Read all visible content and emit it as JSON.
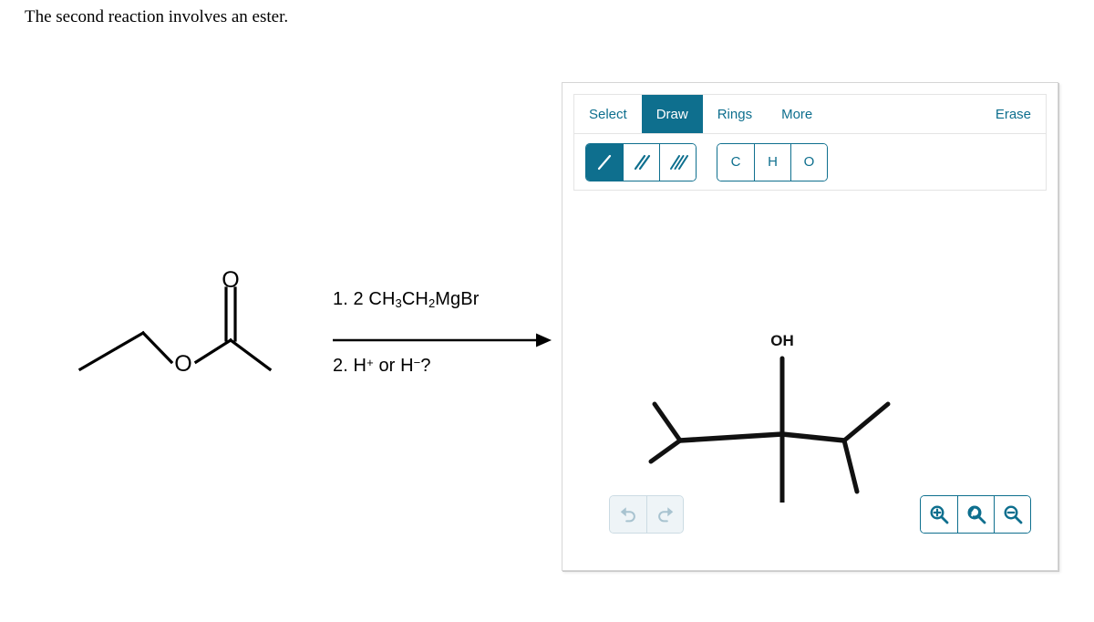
{
  "prompt": "The second reaction involves an ester.",
  "reaction": {
    "reagent_line_1_prefix": "1. 2 CH",
    "reagent_line_1": "1. 2 CH3CH2MgBr",
    "reagent_line_2": "2. H+ or H-?",
    "parts_line_1": {
      "num": "1. 2 CH",
      "sub1": "3",
      "mid": "CH",
      "sub2": "2",
      "tail": "MgBr"
    },
    "parts_line_2": {
      "num": "2. H",
      "sup1": "+",
      "mid": " or H",
      "sup2": "−",
      "tail": "?"
    },
    "reactant_name": "ethyl-acetate-structure",
    "reactant_atom_label": "O",
    "reactant_carbonyl_label": "O",
    "arrow": "reaction-arrow"
  },
  "editor": {
    "tabs": [
      {
        "label": "Select",
        "name": "tab-select",
        "active": false
      },
      {
        "label": "Draw",
        "name": "tab-draw",
        "active": true
      },
      {
        "label": "Rings",
        "name": "tab-rings",
        "active": false
      },
      {
        "label": "More",
        "name": "tab-more",
        "active": false
      }
    ],
    "erase_label": "Erase",
    "bond_buttons": [
      {
        "icon": "single-bond-icon",
        "active": true
      },
      {
        "icon": "double-bond-icon",
        "active": false
      },
      {
        "icon": "triple-bond-icon",
        "active": false
      }
    ],
    "atom_buttons": [
      {
        "label": "C",
        "name": "atom-button-c"
      },
      {
        "label": "H",
        "name": "atom-button-h"
      },
      {
        "label": "O",
        "name": "atom-button-o"
      }
    ],
    "history_buttons": [
      {
        "icon": "undo-icon",
        "name": "undo-button"
      },
      {
        "icon": "redo-icon",
        "name": "redo-button"
      }
    ],
    "zoom_buttons": [
      {
        "icon": "zoom-in-icon",
        "name": "zoom-in-button"
      },
      {
        "icon": "zoom-reset-icon",
        "name": "zoom-reset-button"
      },
      {
        "icon": "zoom-out-icon",
        "name": "zoom-out-button"
      }
    ],
    "canvas": {
      "molecule_name": "drawn-tertiary-alcohol",
      "hydroxyl_label": "OH"
    }
  },
  "colors": {
    "accent": "#0e6f8e",
    "accent_text": "#0e6f8e",
    "panel_border": "#d6d6d6",
    "toolbar_border": "#e4e4e4",
    "disabled": "#a8c3d0",
    "stroke": "#000000"
  }
}
